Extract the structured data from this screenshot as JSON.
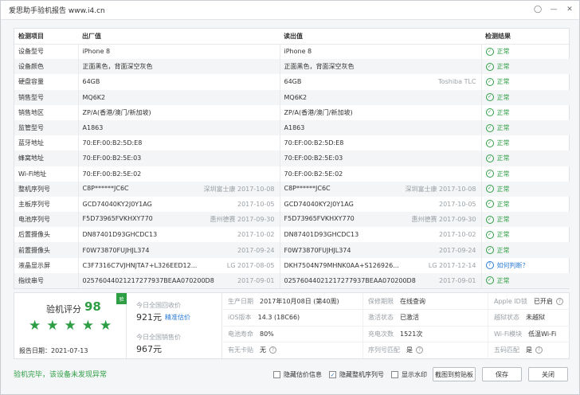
{
  "window": {
    "title": "爱思助手验机报告 www.i4.cn",
    "icons": [
      "pin-icon",
      "minimize-icon",
      "close-icon"
    ]
  },
  "table": {
    "headers": [
      "检测项目",
      "出厂值",
      "读出值",
      "检测结果"
    ],
    "rows": [
      {
        "item": "设备型号",
        "factory": "iPhone 8",
        "factory_sub": "",
        "read": "iPhone 8",
        "read_sub": "",
        "result": "正常",
        "status": "ok"
      },
      {
        "item": "设备颜色",
        "factory": "正面黑色，背面深空灰色",
        "factory_sub": "",
        "read": "正面黑色，背面深空灰色",
        "read_sub": "",
        "result": "正常",
        "status": "ok"
      },
      {
        "item": "硬盘容量",
        "factory": "64GB",
        "factory_sub": "",
        "read": "64GB",
        "read_sub": "Toshiba TLC",
        "result": "正常",
        "status": "ok"
      },
      {
        "item": "销售型号",
        "factory": "MQ6K2",
        "factory_sub": "",
        "read": "MQ6K2",
        "read_sub": "",
        "result": "正常",
        "status": "ok"
      },
      {
        "item": "销售地区",
        "factory": "ZP/A(香港/澳门/新加坡)",
        "factory_sub": "",
        "read": "ZP/A(香港/澳门/新加坡)",
        "read_sub": "",
        "result": "正常",
        "status": "ok"
      },
      {
        "item": "监管型号",
        "factory": "A1863",
        "factory_sub": "",
        "read": "A1863",
        "read_sub": "",
        "result": "正常",
        "status": "ok"
      },
      {
        "item": "蓝牙地址",
        "factory": "70:EF:00:B2:5D:E8",
        "factory_sub": "",
        "read": "70:EF:00:B2:5D:E8",
        "read_sub": "",
        "result": "正常",
        "status": "ok"
      },
      {
        "item": "蜂窝地址",
        "factory": "70:EF:00:B2:5E:03",
        "factory_sub": "",
        "read": "70:EF:00:B2:5E:03",
        "read_sub": "",
        "result": "正常",
        "status": "ok"
      },
      {
        "item": "Wi-Fi地址",
        "factory": "70:EF:00:B2:5E:02",
        "factory_sub": "",
        "read": "70:EF:00:B2:5E:02",
        "read_sub": "",
        "result": "正常",
        "status": "ok"
      },
      {
        "item": "整机序列号",
        "factory": "C8P******JC6C",
        "factory_sub": "深圳富士康  2017-10-08",
        "read": "C8P******JC6C",
        "read_sub": "深圳富士康  2017-10-08",
        "result": "正常",
        "status": "ok"
      },
      {
        "item": "主板序列号",
        "factory": "GCD74040KY2J0Y1AG",
        "factory_sub": "2017-10-05",
        "read": "GCD74040KY2J0Y1AG",
        "read_sub": "2017-10-05",
        "result": "正常",
        "status": "ok"
      },
      {
        "item": "电池序列号",
        "factory": "F5D73965FVKHXY770",
        "factory_sub": "惠州德赛  2017-09-30",
        "read": "F5D73965FVKHXY770",
        "read_sub": "惠州德赛  2017-09-30",
        "result": "正常",
        "status": "ok"
      },
      {
        "item": "后置摄像头",
        "factory": "DN87401D93GHCDC13",
        "factory_sub": "2017-10-02",
        "read": "DN87401D93GHCDC13",
        "read_sub": "2017-10-02",
        "result": "正常",
        "status": "ok"
      },
      {
        "item": "前置摄像头",
        "factory": "F0W73870FUJHJL374",
        "factory_sub": "2017-09-24",
        "read": "F0W73870FUJHJL374",
        "read_sub": "2017-09-24",
        "result": "正常",
        "status": "ok"
      },
      {
        "item": "液晶显示屏",
        "factory": "C3F7316C7VJHNJTA7+L326EED12...",
        "factory_sub": "LG  2017-08-05",
        "read": "DKH7504N79MHNK0AA+S126926...",
        "read_sub": "LG  2017-12-14",
        "result": "如何判断？",
        "status": "question"
      },
      {
        "item": "指纹串号",
        "factory": "02576044021217277937BEAA070200D8",
        "factory_sub": "2017-09-01",
        "read": "02576044021217277937BEAA070200D8",
        "read_sub": "2017-09-01",
        "result": "正常",
        "status": "ok"
      }
    ]
  },
  "summary": {
    "score_label": "验机评分",
    "score": "98",
    "stars": 5,
    "badge": "验",
    "report_date": "报告日期：2021-07-13",
    "recycle_label": "今日全国回收价",
    "recycle_price": "921元",
    "estimate_link": "精准估价",
    "sale_label": "今日全国销售价",
    "sale_price": "967元",
    "info": {
      "prod_date_label": "生产日期",
      "prod_date": "2017年10月08日 (第40周)",
      "warranty_label": "保修期限",
      "warranty": "在线查询",
      "appleid_label": "Apple ID锁",
      "appleid": "已开启",
      "ios_label": "iOS版本",
      "ios": "14.3 (18C66)",
      "activation_label": "激活状态",
      "activation": "已激活",
      "jailbreak_label": "越狱状态",
      "jailbreak": "未越狱",
      "battery_label": "电池寿命",
      "battery": "80%",
      "charge_label": "充电次数",
      "charge": "1521次",
      "wifi_label": "Wi-Fi模块",
      "wifi": "低温Wi-Fi",
      "sim_label": "有无卡贴",
      "sim": "无",
      "serial_label": "序列号匹配",
      "serial": "是",
      "fivecode_label": "五码匹配",
      "fivecode": "是"
    }
  },
  "footer": {
    "status": "验机完毕，该设备未发现异常",
    "hide_price": "隐藏估价信息",
    "hide_serial": "隐藏整机序列号",
    "show_watermark": "显示水印",
    "copy_button": "截图到剪贴板",
    "save_button": "保存",
    "close_button": "关闭"
  },
  "colors": {
    "accent": "#2e9e45",
    "link": "#2b7bd6",
    "alert": "#e03a3a"
  }
}
